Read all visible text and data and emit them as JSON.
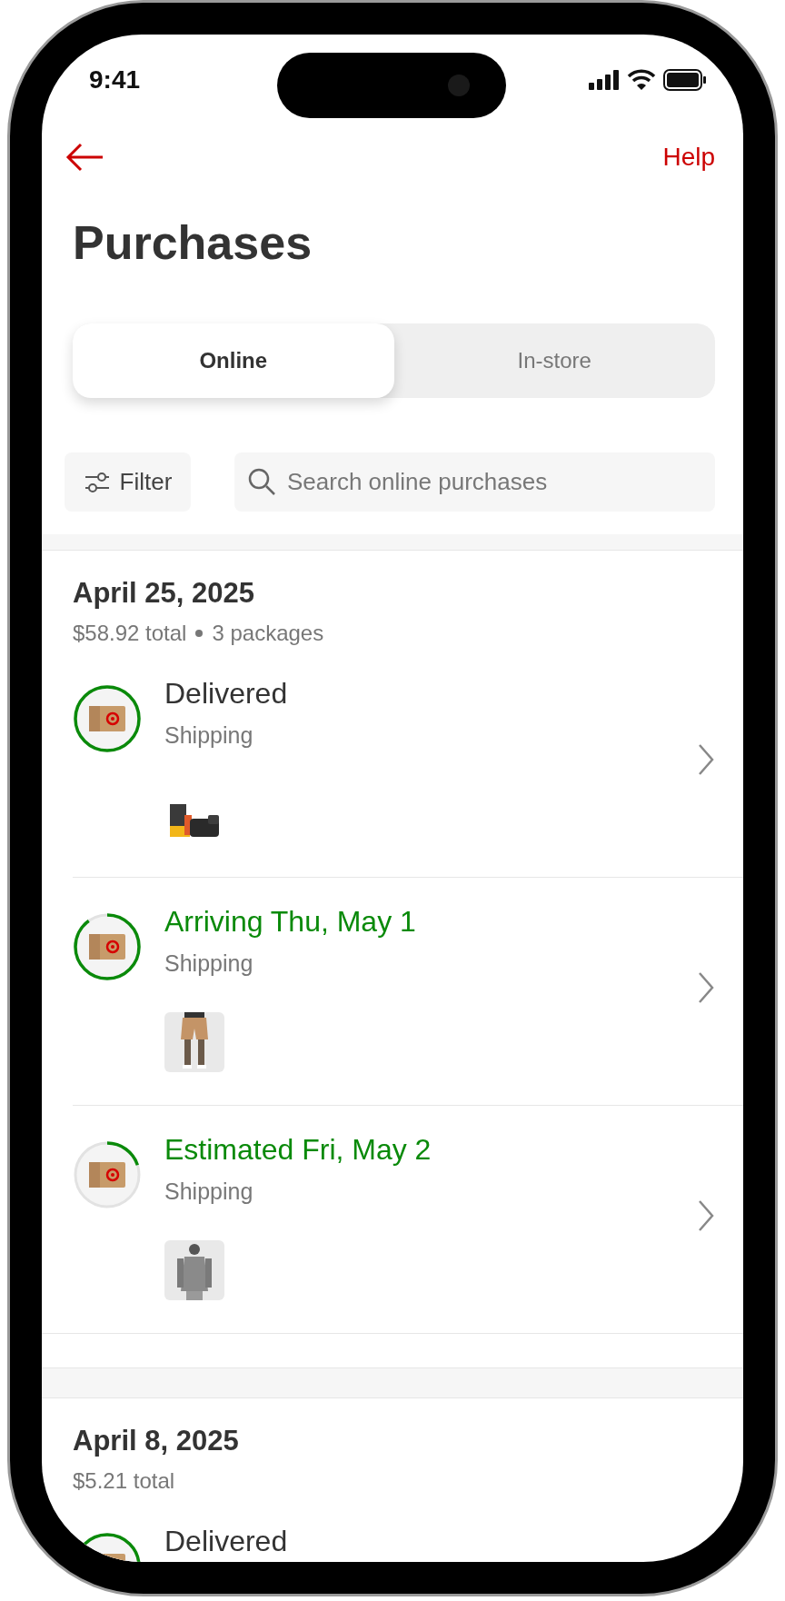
{
  "status_bar": {
    "time": "9:41"
  },
  "nav": {
    "help": "Help"
  },
  "title": "Purchases",
  "tabs": [
    {
      "label": "Online",
      "selected": true
    },
    {
      "label": "In-store",
      "selected": false
    }
  ],
  "filter": {
    "label": "Filter"
  },
  "search": {
    "placeholder": "Search online purchases"
  },
  "orders": [
    {
      "date": "April 25, 2025",
      "total": "$58.92 total",
      "packages": "3 packages",
      "shipments": [
        {
          "kind": "delivered",
          "status": "Delivered",
          "delivered": true,
          "method": "Shipping"
        },
        {
          "kind": "arriving",
          "status": "Arriving Thu, May 1",
          "delivered": false,
          "method": "Shipping"
        },
        {
          "kind": "estimated",
          "status": "Estimated Fri, May 2",
          "delivered": false,
          "method": "Shipping"
        }
      ]
    },
    {
      "date": "April 8, 2025",
      "total": "$5.21 total",
      "shipments": [
        {
          "kind": "delivered",
          "status": "Delivered",
          "delivered": true
        }
      ]
    }
  ]
}
